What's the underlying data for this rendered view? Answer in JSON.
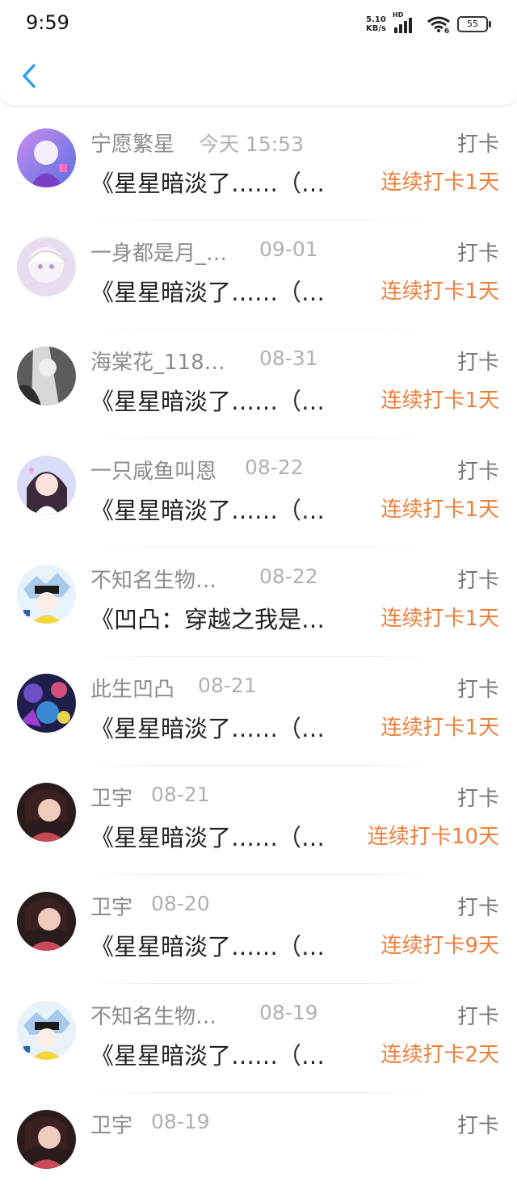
{
  "status_bar": {
    "time": "9:59",
    "net_speed_value": "5.10",
    "net_speed_unit": "KB/s",
    "signal_label": "HD",
    "battery": "55"
  },
  "colors": {
    "accent": "#2a9df4",
    "streak": "#ee7f3b"
  },
  "nav": {
    "back_icon": "chevron-left-icon"
  },
  "feed": [
    {
      "name": "宁愿繁星",
      "time": "今天 15:53",
      "type": "打卡",
      "content": "《星星暗淡了……（…",
      "streak": "连续打卡1天"
    },
    {
      "name": "一身都是月_…",
      "time": "09-01",
      "type": "打卡",
      "content": "《星星暗淡了……（…",
      "streak": "连续打卡1天"
    },
    {
      "name": "海棠花_118…",
      "time": "08-31",
      "type": "打卡",
      "content": "《星星暗淡了……（…",
      "streak": "连续打卡1天"
    },
    {
      "name": "一只咸鱼叫恩",
      "time": "08-22",
      "type": "打卡",
      "content": "《星星暗淡了……（…",
      "streak": "连续打卡1天"
    },
    {
      "name": "不知名生物…",
      "time": "08-22",
      "type": "打卡",
      "content": "《凹凸：穿越之我是…",
      "streak": "连续打卡1天"
    },
    {
      "name": "此生凹凸",
      "time": "08-21",
      "type": "打卡",
      "content": "《星星暗淡了……（…",
      "streak": "连续打卡1天"
    },
    {
      "name": "卫宇",
      "time": "08-21",
      "type": "打卡",
      "content": "《星星暗淡了……（…",
      "streak": "连续打卡10天"
    },
    {
      "name": "卫宇",
      "time": "08-20",
      "type": "打卡",
      "content": "《星星暗淡了……（…",
      "streak": "连续打卡9天"
    },
    {
      "name": "不知名生物…",
      "time": "08-19",
      "type": "打卡",
      "content": "《星星暗淡了……（…",
      "streak": "连续打卡2天"
    },
    {
      "name": "卫宇",
      "time": "08-19",
      "type": "打卡",
      "content": "",
      "streak": ""
    }
  ]
}
